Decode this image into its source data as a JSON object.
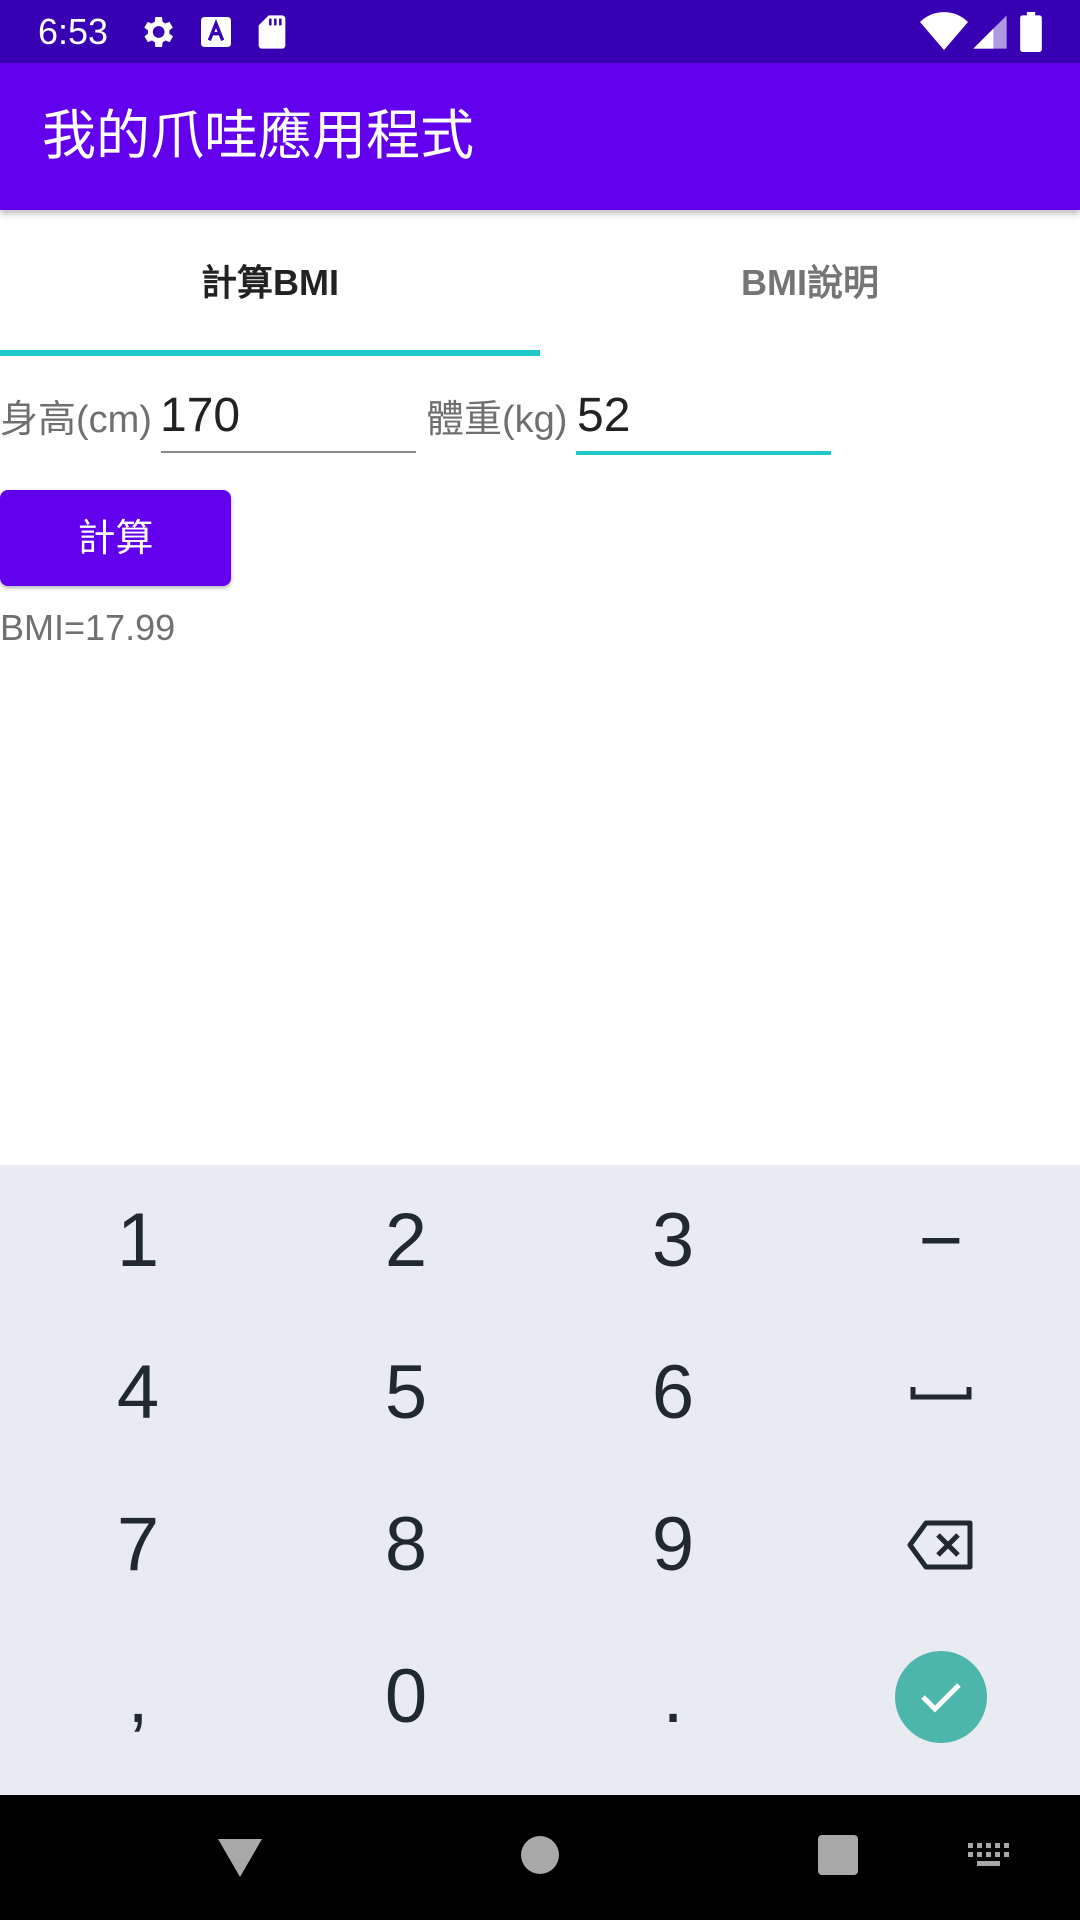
{
  "status_bar": {
    "time": "6:53",
    "icons": [
      "settings-icon",
      "text-a-icon",
      "sd-card-icon",
      "wifi-icon",
      "cell-signal-icon",
      "battery-icon"
    ]
  },
  "app_bar": {
    "title": "我的爪哇應用程式"
  },
  "tabs": [
    {
      "label": "計算BMI",
      "selected": true
    },
    {
      "label": "BMI說明",
      "selected": false
    }
  ],
  "form": {
    "height_label": "身高(cm)",
    "height_value": "170",
    "weight_label": "體重(kg)",
    "weight_value": "52",
    "calc_button": "計算",
    "result": "BMI=17.99"
  },
  "keyboard": {
    "keys": [
      "1",
      "2",
      "3",
      "−",
      "4",
      "5",
      "6",
      "space-icon",
      "7",
      "8",
      "9",
      "backspace-icon",
      ",",
      "0",
      ".",
      "enter-check-icon"
    ]
  },
  "colors": {
    "status_bar": "#3700b3",
    "primary": "#6200ee",
    "accent": "#1ec8c8",
    "enter_key": "#4db6ac",
    "keyboard_bg": "#e8ecf0"
  },
  "nav_bar": {
    "buttons": [
      "back-icon",
      "home-icon",
      "recents-icon",
      "keyboard-switch-icon"
    ]
  }
}
